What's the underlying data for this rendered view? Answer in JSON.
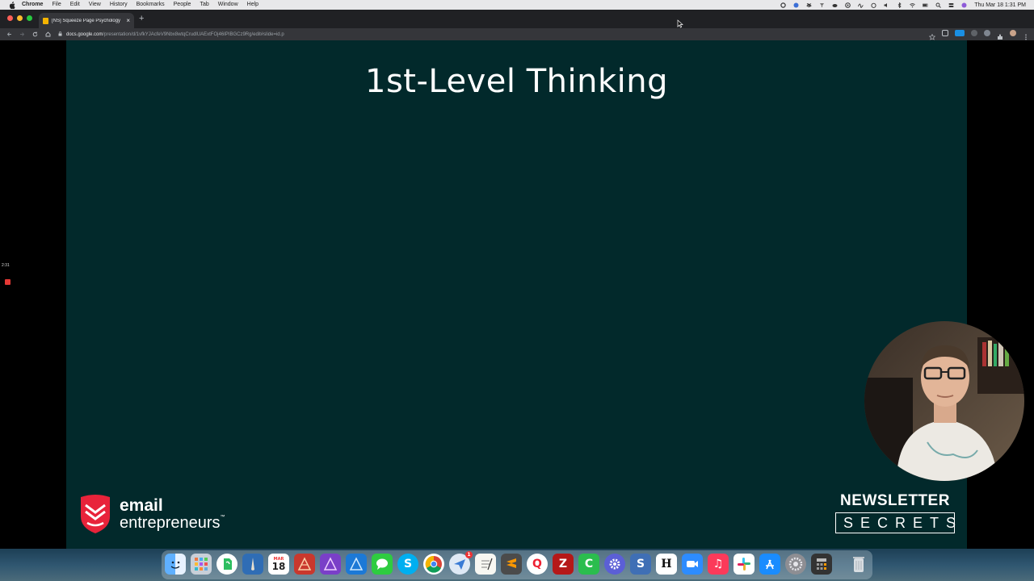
{
  "menubar": {
    "app_name": "Chrome",
    "items": [
      "File",
      "Edit",
      "View",
      "History",
      "Bookmarks",
      "People",
      "Tab",
      "Window",
      "Help"
    ],
    "clock": "Thu Mar 18  1:31 PM"
  },
  "browser": {
    "tab_title": "[NS] Squeeze Page Psychology",
    "tab_close": "×",
    "new_tab": "+",
    "url_domain": "docs.google.com",
    "url_path": "/presentation/d/1vfkYJAcfeV9Nbx8wtqCrudlUAExtFOj46IPIBGCz9Rg/edit#slide=id.p"
  },
  "recorder": {
    "timer": "2:31"
  },
  "slide": {
    "title": "1st-Level Thinking",
    "brand_left": {
      "line1": "email",
      "line2": "entrepreneurs",
      "tm": "™"
    },
    "brand_right": {
      "line1": "NEWSLETTER",
      "line2": "SECRETS"
    },
    "background_color": "#02292b"
  },
  "dock": {
    "calendar_month": "MAR",
    "calendar_day": "18",
    "mail_badge": "1",
    "apps": [
      "finder-icon",
      "launchpad-icon",
      "evernote-icon",
      "scrivener-icon",
      "calendar-icon",
      "affinity-publisher-icon",
      "affinity-photo-icon",
      "affinity-designer-icon",
      "messages-icon",
      "skype-icon",
      "chrome-icon",
      "airmail-icon",
      "textedit-icon",
      "sublime-text-icon",
      "quip-icon",
      "filezilla-icon",
      "camtasia-icon",
      "settings-gear-icon",
      "scrivener-s-icon",
      "hemingway-icon",
      "zoom-icon",
      "music-icon",
      "slack-icon",
      "app-store-icon",
      "system-preferences-icon",
      "calculator-icon",
      "trash-icon"
    ]
  }
}
